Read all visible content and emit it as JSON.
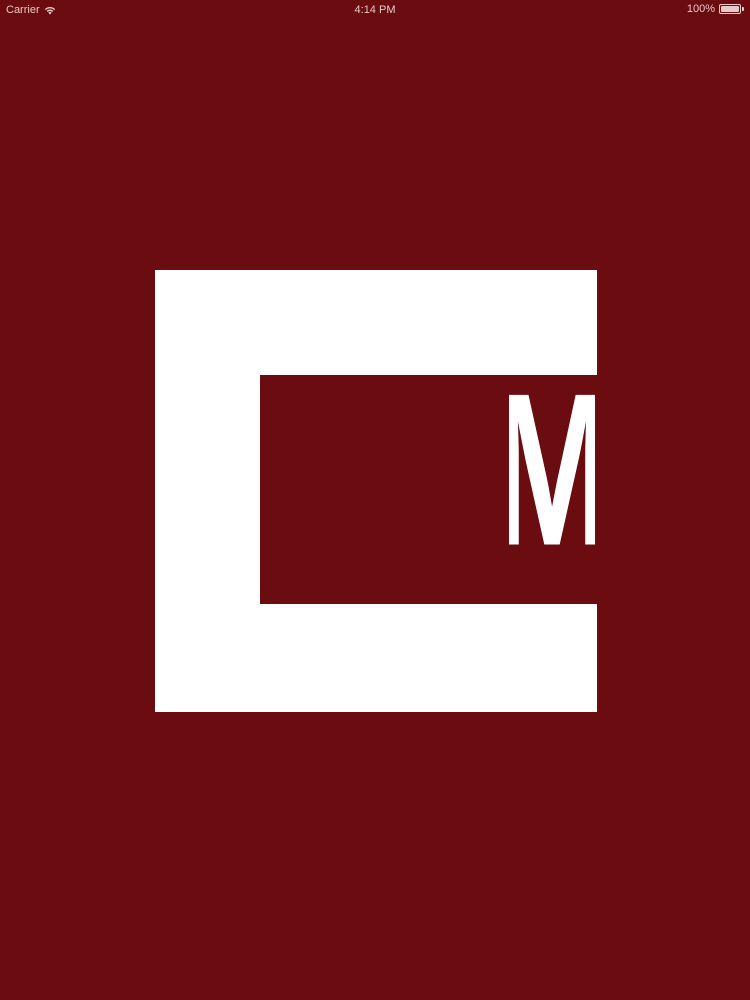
{
  "status_bar": {
    "carrier": "Carrier",
    "wifi_icon": "wifi-icon",
    "time": "4:14 PM",
    "battery_percent_label": "100%",
    "battery_level": 1.0
  },
  "logo": {
    "letter": "M",
    "colors": {
      "background": "#6b0c10",
      "mark": "#ffffff"
    }
  }
}
